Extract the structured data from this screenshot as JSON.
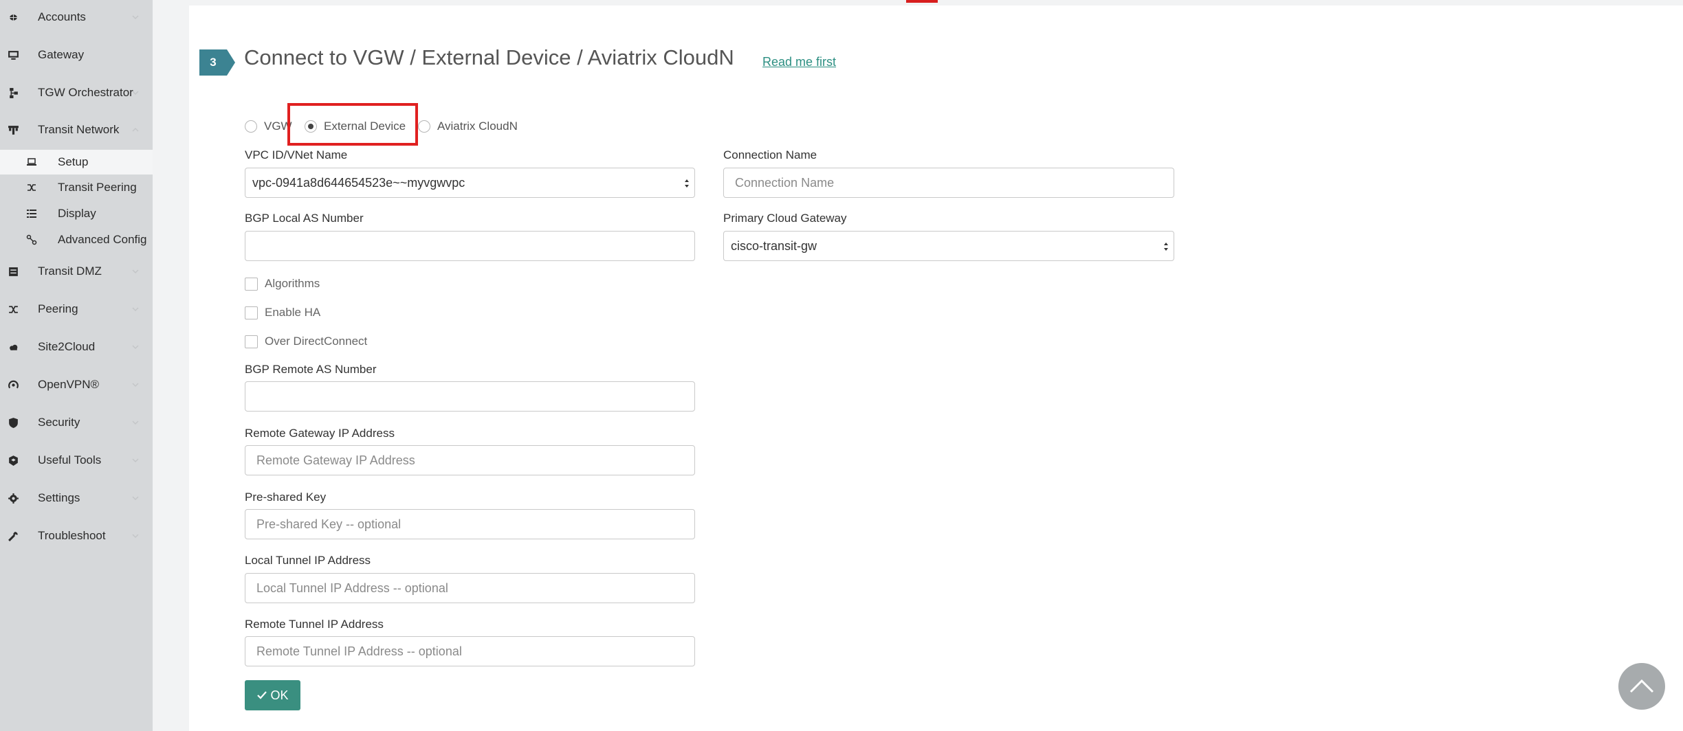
{
  "sidebar": {
    "items": [
      {
        "label": "Accounts",
        "icon": "accounts-icon"
      },
      {
        "label": "Gateway",
        "icon": "monitor-icon"
      },
      {
        "label": "TGW Orchestrator",
        "icon": "network-tree-icon"
      },
      {
        "label": "Transit Network",
        "icon": "transit-network-icon"
      },
      {
        "label": "Transit DMZ",
        "icon": "dmz-icon"
      },
      {
        "label": "Peering",
        "icon": "shuffle-icon"
      },
      {
        "label": "Site2Cloud",
        "icon": "cloud-icon"
      },
      {
        "label": "OpenVPN®",
        "icon": "vpn-icon"
      },
      {
        "label": "Security",
        "icon": "shield-icon"
      },
      {
        "label": "Useful Tools",
        "icon": "tools-icon"
      },
      {
        "label": "Settings",
        "icon": "gear-icon"
      },
      {
        "label": "Troubleshoot",
        "icon": "wrench-icon"
      }
    ],
    "sub_items": [
      {
        "label": "Setup",
        "icon": "laptop-icon",
        "active": true
      },
      {
        "label": "Transit Peering",
        "icon": "shuffle-icon",
        "active": false
      },
      {
        "label": "Display",
        "icon": "list-icon",
        "active": false
      },
      {
        "label": "Advanced Config",
        "icon": "link-icon",
        "active": false
      }
    ]
  },
  "step": {
    "number": "3",
    "title": "Connect to VGW / External Device / Aviatrix CloudN",
    "read_me_link": "Read me first"
  },
  "connection_type": {
    "options": [
      "VGW",
      "External Device",
      "Aviatrix CloudN"
    ],
    "selected": "External Device"
  },
  "form": {
    "vpc_label": "VPC ID/VNet Name",
    "vpc_value": "vpc-0941a8d644654523e~~myvgwvpc",
    "connection_name_label": "Connection Name",
    "connection_name_placeholder": "Connection Name",
    "bgp_local_label": "BGP Local AS Number",
    "bgp_local_value": "",
    "primary_gw_label": "Primary Cloud Gateway",
    "primary_gw_value": "cisco-transit-gw",
    "checkboxes": [
      {
        "label": "Algorithms",
        "checked": false
      },
      {
        "label": "Enable HA",
        "checked": false
      },
      {
        "label": "Over DirectConnect",
        "checked": false
      }
    ],
    "bgp_remote_label": "BGP Remote AS Number",
    "bgp_remote_value": "",
    "remote_gw_ip_label": "Remote Gateway IP Address",
    "remote_gw_ip_placeholder": "Remote Gateway IP Address",
    "psk_label": "Pre-shared Key",
    "psk_placeholder": "Pre-shared Key -- optional",
    "local_tunnel_label": "Local Tunnel IP Address",
    "local_tunnel_placeholder": "Local Tunnel IP Address -- optional",
    "remote_tunnel_label": "Remote Tunnel IP Address",
    "remote_tunnel_placeholder": "Remote Tunnel IP Address -- optional",
    "ok_label": "OK"
  },
  "colors": {
    "accent": "#2c8f82",
    "badge": "#3c8392",
    "ok_button": "#3a8f80",
    "highlight": "#e02020",
    "sidebar_bg": "#d6d8da"
  }
}
